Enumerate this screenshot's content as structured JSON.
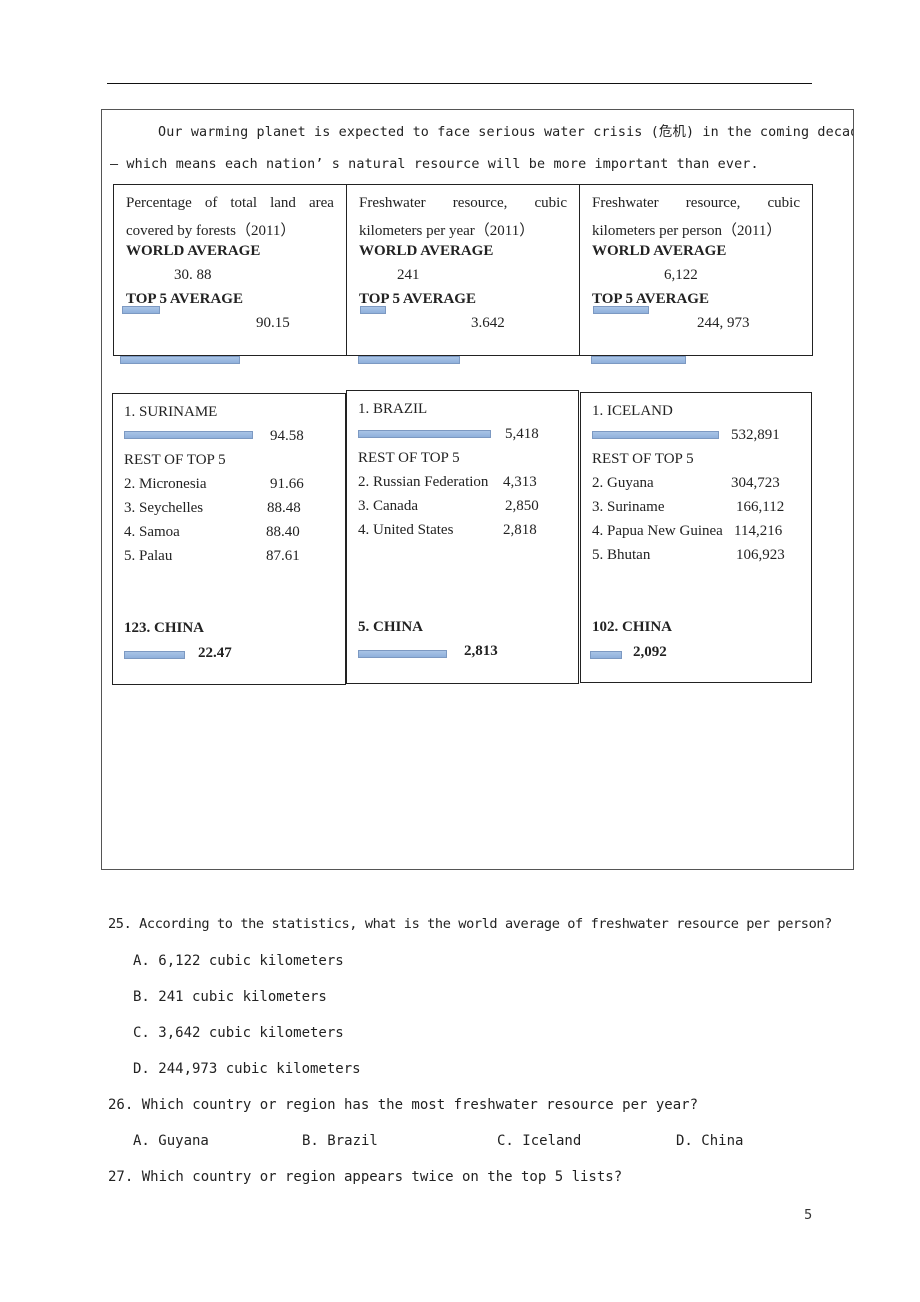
{
  "intro": {
    "line1": "Our warming planet is expected to face serious water crisis (危机) in the coming decad",
    "line2": "— which means each nation’ s natural resource will be more important than ever."
  },
  "top_cards": [
    {
      "title_words_1": [
        "Percentage",
        "of",
        "total",
        "land",
        "area"
      ],
      "title_line_2": "covered by forests（2011）",
      "world_label": "WORLD AVERAGE",
      "world_value": "30. 88",
      "top5_label": "TOP 5 AVERAGE",
      "top5_value": "90.15"
    },
    {
      "title_words_1": [
        "Freshwater",
        "resource,",
        "cubic"
      ],
      "title_line_2": "kilometers per year（2011）",
      "world_label": "WORLD AVERAGE",
      "world_value": "241",
      "top5_label": "TOP 5 AVERAGE",
      "top5_value": "3.642"
    },
    {
      "title_words_1": [
        "Freshwater",
        "resource,",
        "cubic"
      ],
      "title_line_2": "kilometers per person（2011）",
      "world_label": "WORLD AVERAGE",
      "world_value": "6,122",
      "top5_label": "TOP 5 AVERAGE",
      "top5_value": "244, 973"
    }
  ],
  "bottom_cards": [
    {
      "first": {
        "name": "1. SURINAME",
        "value": "94.58"
      },
      "rest_label": "REST OF TOP 5",
      "rest": [
        {
          "name": "2. Micronesia",
          "value": "91.66"
        },
        {
          "name": "3. Seychelles",
          "value": "88.48"
        },
        {
          "name": "4. Samoa",
          "value": "88.40"
        },
        {
          "name": "5. Palau",
          "value": "87.61"
        }
      ],
      "china": {
        "rank": "123. CHINA",
        "value": "22.47"
      }
    },
    {
      "first": {
        "name": "1. BRAZIL",
        "value": "5,418"
      },
      "rest_label": "REST OF TOP 5",
      "rest": [
        {
          "name": "2. Russian Federation",
          "value": "4,313"
        },
        {
          "name": "3. Canada",
          "value": "2,850"
        },
        {
          "name": "4. United States",
          "value": "2,818"
        }
      ],
      "china": {
        "rank": "5. CHINA",
        "value": "2,813"
      }
    },
    {
      "first": {
        "name": "1. ICELAND",
        "value": "532,891"
      },
      "rest_label": "REST OF TOP 5",
      "rest": [
        {
          "name": "2. Guyana",
          "value": "304,723"
        },
        {
          "name": "3. Suriname",
          "value": "166,112"
        },
        {
          "name": "4. Papua New Guinea",
          "value": "114,216"
        },
        {
          "name": "5. Bhutan",
          "value": "106,923"
        }
      ],
      "china": {
        "rank": "102. CHINA",
        "value": "2,092"
      }
    }
  ],
  "questions": [
    {
      "text": "25. According to the statistics, what is the world average of freshwater resource per person?",
      "options": [
        "A. 6,122 cubic kilometers",
        "B. 241 cubic kilometers",
        "C. 3,642 cubic kilometers",
        "D. 244,973 cubic kilometers"
      ]
    },
    {
      "text": "26.  Which country or region has the most freshwater resource per year?",
      "options": [
        "A. Guyana",
        "B. Brazil",
        "C. Iceland",
        "D. China"
      ]
    },
    {
      "text": "27.  Which country or region appears twice on the top 5 lists?",
      "options": []
    }
  ],
  "colors": {
    "bar_fill": "#9dbbe2",
    "bar_border": "#7c99c2",
    "border": "#222222"
  },
  "page_number": "5"
}
